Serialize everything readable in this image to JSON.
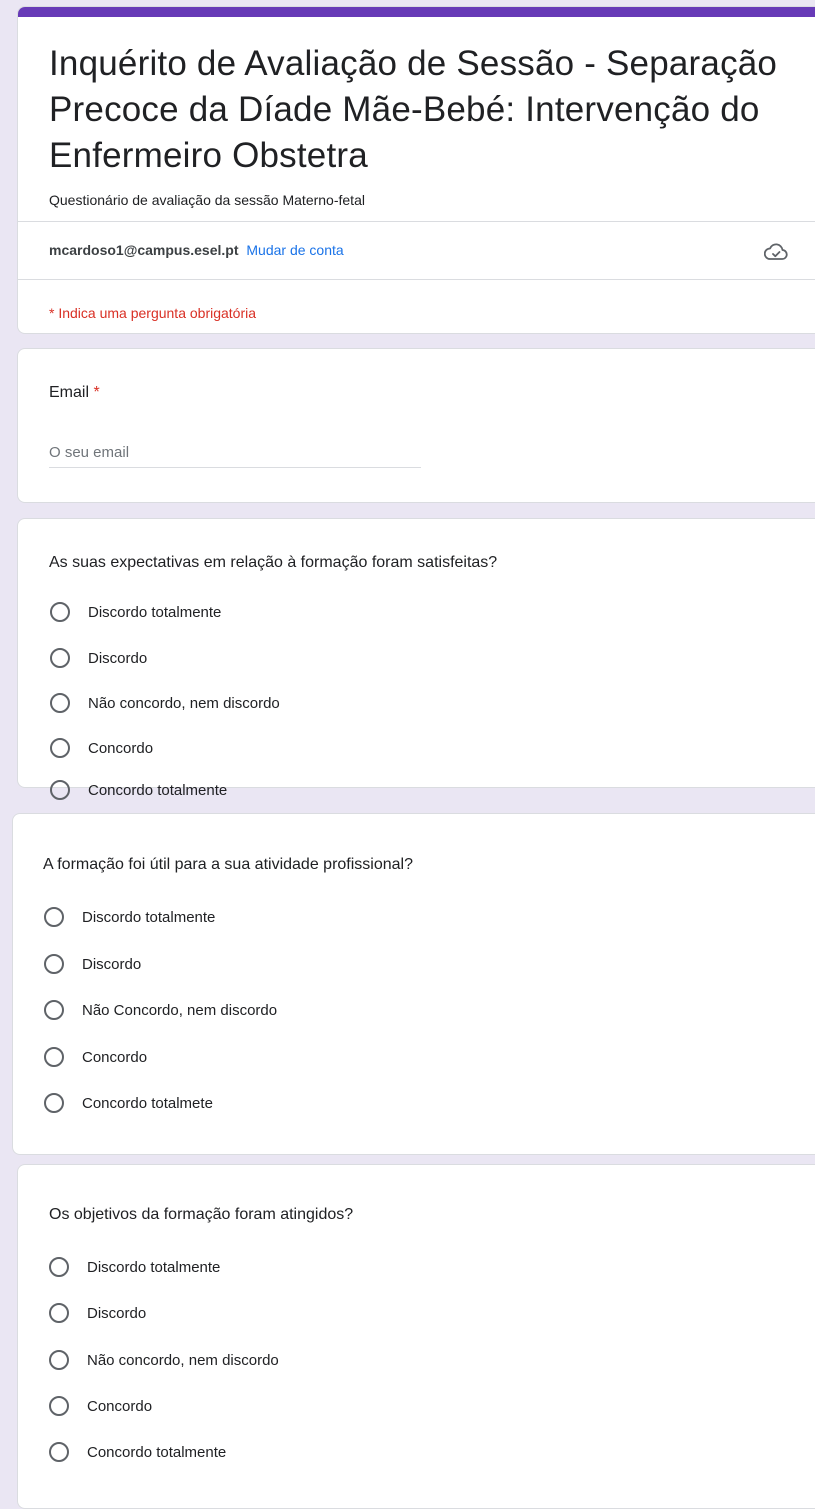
{
  "header": {
    "title": "Inquérito de Avaliação de Sessão - Separação Precoce da Díade Mãe-Bebé: Intervenção do Enfermeiro Obstetra",
    "description": "Questionário de avaliação da sessão Materno-fetal",
    "account_email": "mcardoso1@campus.esel.pt",
    "switch_account": "Mudar de conta",
    "required_note": "* Indica uma pergunta obrigatória",
    "accent_color": "#673ab7"
  },
  "email_question": {
    "label": "Email",
    "required_marker": "*",
    "placeholder": "O seu email"
  },
  "questions": [
    {
      "label": "As suas expectativas em relação à formação foram satisfeitas?",
      "options": [
        "Discordo totalmente",
        "Discordo",
        "Não concordo, nem discordo",
        "Concordo",
        "Concordo totalmente"
      ]
    },
    {
      "label": "A formação foi útil para a sua atividade profissional?",
      "options": [
        "Discordo totalmente",
        "Discordo",
        "Não Concordo, nem discordo",
        "Concordo",
        "Concordo totalmete"
      ]
    },
    {
      "label": "Os objetivos da formação foram atingidos?",
      "options": [
        "Discordo totalmente",
        "Discordo",
        "Não concordo, nem discordo",
        "Concordo",
        "Concordo totalmente"
      ]
    }
  ]
}
